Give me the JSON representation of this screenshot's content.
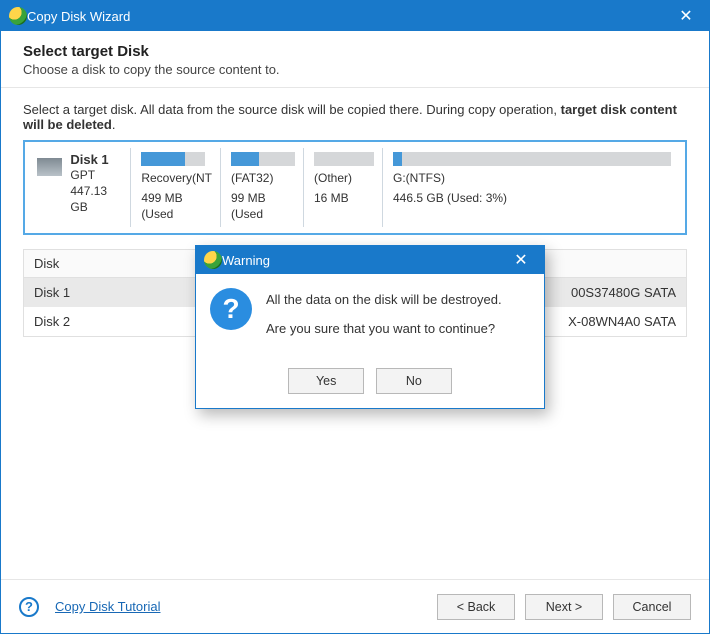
{
  "window": {
    "title": "Copy Disk Wizard"
  },
  "header": {
    "title": "Select target Disk",
    "subtitle": "Choose a disk to copy the source content to."
  },
  "instruction": {
    "pre": "Select a target disk. All data from the source disk will be copied there. During copy operation, ",
    "bold": "target disk content will be deleted",
    "post": "."
  },
  "selectedDisk": {
    "name": "Disk 1",
    "scheme": "GPT",
    "size": "447.13 GB",
    "parts": {
      "recovery": {
        "label": "Recovery(NT",
        "size": "499 MB (Used"
      },
      "fat": {
        "label": "(FAT32)",
        "size": "99 MB (Used"
      },
      "other": {
        "label": "(Other)",
        "size": "16 MB"
      },
      "g": {
        "label": "G:(NTFS)",
        "size": "446.5 GB (Used: 3%)"
      }
    }
  },
  "table": {
    "header": "Disk",
    "rows": [
      {
        "name": "Disk 1",
        "desc_suffix": "00S37480G SATA"
      },
      {
        "name": "Disk 2",
        "desc_suffix": "X-08WN4A0 SATA"
      }
    ]
  },
  "footer": {
    "helpLink": "Copy Disk Tutorial",
    "back": "<  Back",
    "next": "Next  >",
    "cancel": "Cancel"
  },
  "modal": {
    "title": "Warning",
    "line1": "All the data on the disk will be destroyed.",
    "line2": "Are you sure that you want to continue?",
    "yes": "Yes",
    "no": "No"
  }
}
